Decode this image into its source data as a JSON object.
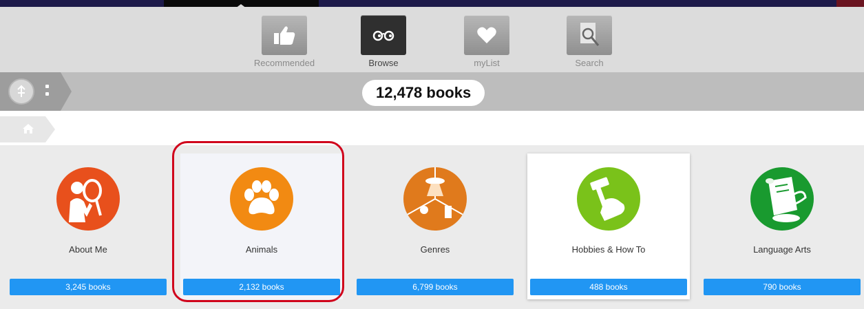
{
  "nav": {
    "items": [
      {
        "label": "Recommended",
        "icon": "thumbs-up-icon",
        "active": false
      },
      {
        "label": "Browse",
        "icon": "glasses-icon",
        "active": true
      },
      {
        "label": "myList",
        "icon": "heart-icon",
        "active": false
      },
      {
        "label": "Search",
        "icon": "search-icon",
        "active": false
      }
    ]
  },
  "count_bar": {
    "total": "12,478 books",
    "profile_icon": "profile-icon",
    "menu_icon": "kebab-menu-icon"
  },
  "breadcrumb": {
    "home_icon": "home-icon"
  },
  "categories": [
    {
      "label": "About Me",
      "count": "3,245 books",
      "color": "#e8501c",
      "icon": "mirror-person-icon"
    },
    {
      "label": "Animals",
      "count": "2,132 books",
      "color": "#f28a12",
      "icon": "paw-icon",
      "selected": true
    },
    {
      "label": "Genres",
      "count": "6,799 books",
      "color": "#e07a1c",
      "icon": "genres-collage-icon"
    },
    {
      "label": "Hobbies & How To",
      "count": "488 books",
      "color": "#7ac21a",
      "icon": "hammer-fist-icon"
    },
    {
      "label": "Language Arts",
      "count": "790 books",
      "color": "#199a2f",
      "icon": "scroll-quill-icon"
    }
  ],
  "colors": {
    "accent": "#2196f3",
    "highlight": "#d0021b"
  }
}
